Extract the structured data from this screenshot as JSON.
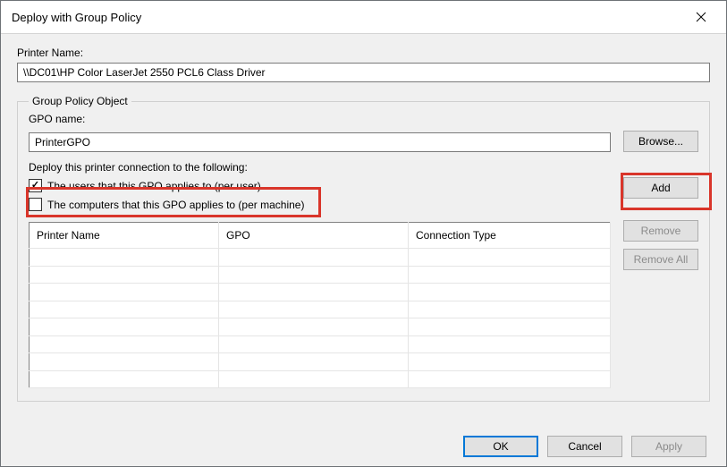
{
  "title": "Deploy with Group Policy",
  "labels": {
    "printer_name": "Printer Name:",
    "gpo_legend": "Group Policy Object",
    "gpo_name": "GPO name:",
    "deploy_to": "Deploy this printer connection to the following:",
    "check_users": "The users that this GPO applies to (per user)",
    "check_machines": "The computers that this GPO applies to (per machine)"
  },
  "values": {
    "printer_name": "\\\\DC01\\HP Color LaserJet 2550 PCL6 Class Driver",
    "gpo_name": "PrinterGPO",
    "check_users": true,
    "check_machines": false
  },
  "buttons": {
    "browse": "Browse...",
    "add": "Add",
    "remove": "Remove",
    "remove_all": "Remove All",
    "ok": "OK",
    "cancel": "Cancel",
    "apply": "Apply"
  },
  "table": {
    "columns": [
      "Printer Name",
      "GPO",
      "Connection Type"
    ],
    "rows": []
  }
}
